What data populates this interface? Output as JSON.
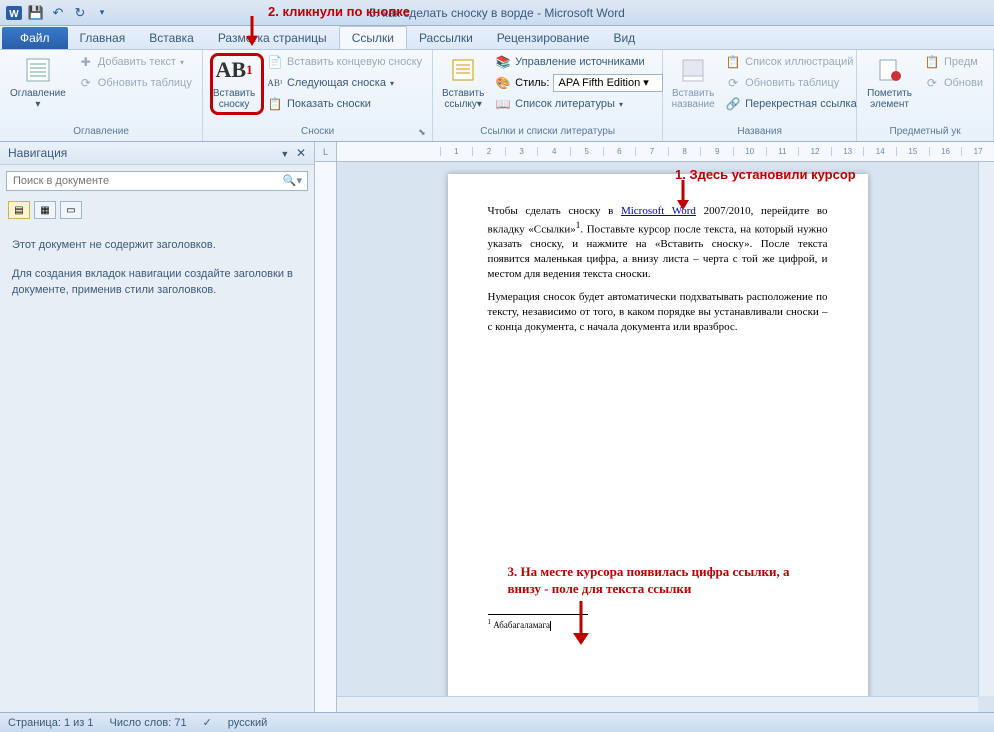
{
  "titlebar": {
    "title": "5. как сделать сноску в ворде - Microsoft Word"
  },
  "annotations": {
    "a1": "1. Здесь установили курсор",
    "a2": "2. кликнули по кнопке",
    "a3": "3. На месте курсора появилась цифра ссылки, а внизу - поле для текста ссылки"
  },
  "file_tab": "Файл",
  "tabs": {
    "home": "Главная",
    "insert": "Вставка",
    "layout": "Разметка страницы",
    "references": "Ссылки",
    "mailings": "Рассылки",
    "review": "Рецензирование",
    "view": "Вид"
  },
  "ribbon": {
    "toc": {
      "label": "Оглавление",
      "big": "Оглавление",
      "add_text": "Добавить текст",
      "update": "Обновить таблицу"
    },
    "footnotes": {
      "label": "Сноски",
      "big1": "Вставить",
      "big2": "сноску",
      "icon": "AB",
      "insert_end": "Вставить концевую сноску",
      "next": "Следующая сноска",
      "show": "Показать сноски"
    },
    "citations": {
      "label": "Ссылки и списки литературы",
      "big1": "Вставить",
      "big2": "ссылку",
      "manage": "Управление источниками",
      "style_label": "Стиль:",
      "style_value": "APA Fifth Edition",
      "biblio": "Список литературы"
    },
    "captions": {
      "label": "Названия",
      "big1": "Вставить",
      "big2": "название",
      "toc_figures": "Список иллюстраций",
      "update": "Обновить таблицу",
      "crossref": "Перекрестная ссылка"
    },
    "index": {
      "label": "Предметный ук",
      "big1": "Пометить",
      "big2": "элемент",
      "item1": "Предм",
      "item2": "Обнови"
    }
  },
  "nav": {
    "title": "Навигация",
    "search_placeholder": "Поиск в документе",
    "msg1": "Этот документ не содержит заголовков.",
    "msg2": "Для создания вкладок навигации создайте заголовки в документе, применив стили заголовков."
  },
  "document": {
    "p1a": "Чтобы сделать сноску в ",
    "p1link": "Microsoft Word",
    "p1b": " 2007/2010, перейдите во вкладку «Ссылки»",
    "p1sup": "1",
    "p1c": ". Поставьте курсор после текста, на который нужно указать сноску, и нажмите на «Вставить сноску». После текста появится маленькая цифра, а внизу листа – черта с той же цифрой, и местом для ведения текста сноски.",
    "p2": "Нумерация сносок будет автоматически подхватывать расположение по тексту, независимо от того, в каком порядке вы устанавливали сноски – с конца документа, с начала документа или вразброс.",
    "footnote_num": "1",
    "footnote_text": " Абабагаламага"
  },
  "ruler": [
    "1",
    "2",
    "3",
    "4",
    "5",
    "6",
    "7",
    "8",
    "9",
    "10",
    "11",
    "12",
    "13",
    "14",
    "15",
    "16",
    "17"
  ],
  "ruler_corner": "L",
  "statusbar": {
    "page": "Страница: 1 из 1",
    "words": "Число слов: 71",
    "lang": "русский"
  }
}
